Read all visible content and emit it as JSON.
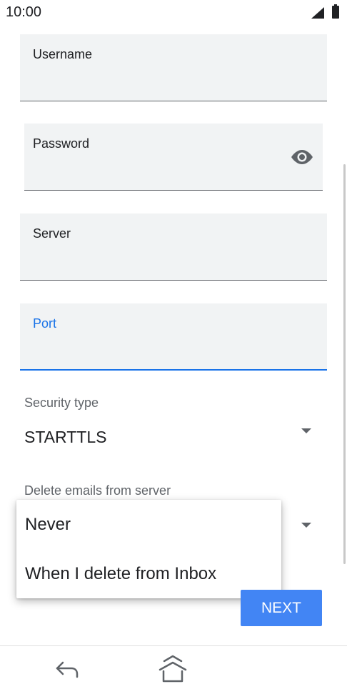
{
  "status_bar": {
    "time": "10:00"
  },
  "fields": {
    "username": {
      "label": "Username",
      "value": ""
    },
    "password": {
      "label": "Password",
      "value": ""
    },
    "server": {
      "label": "Server",
      "value": ""
    },
    "port": {
      "label": "Port",
      "value": ""
    }
  },
  "security": {
    "label": "Security type",
    "value": "STARTTLS"
  },
  "delete_emails": {
    "label": "Delete emails from server"
  },
  "menu": {
    "options": [
      "Never",
      "When I delete from Inbox"
    ]
  },
  "next_button": {
    "label": "NEXT"
  },
  "icons": {
    "password_toggle": "eye-icon",
    "dropdown": "arrow-drop-down-icon",
    "nav_back": "back-icon",
    "nav_home": "home-icon"
  },
  "colors": {
    "accent": "#1a73e8",
    "button": "#4285f4",
    "field_bg": "#f1f3f4"
  }
}
